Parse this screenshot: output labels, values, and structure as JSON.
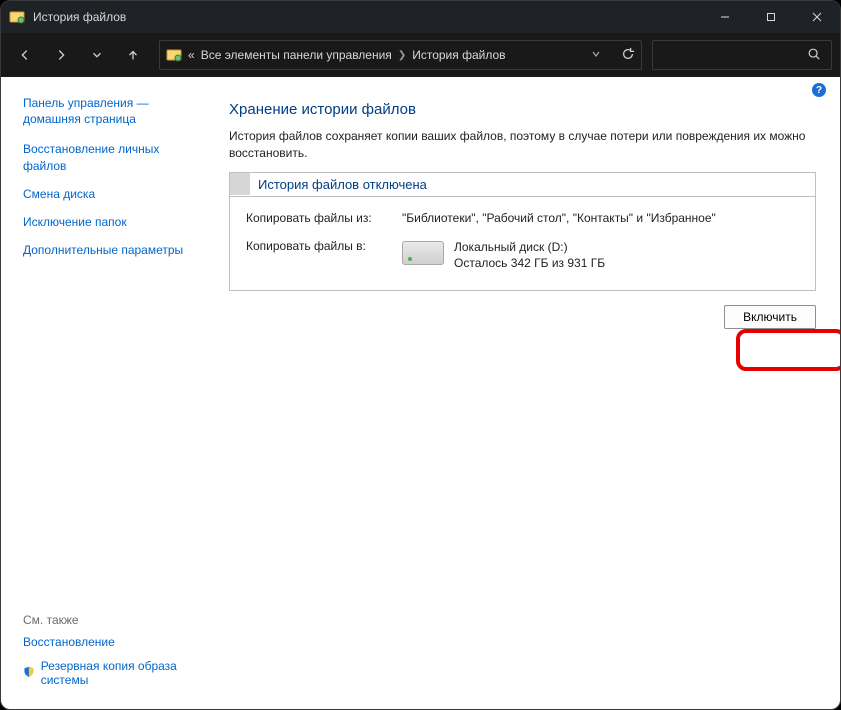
{
  "window": {
    "title": "История файлов"
  },
  "breadcrumb": {
    "prefix": "«",
    "segment1": "Все элементы панели управления",
    "segment2": "История файлов"
  },
  "sidebar": {
    "home": "Панель управления — домашняя страница",
    "links": [
      "Восстановление личных файлов",
      "Смена диска",
      "Исключение папок",
      "Дополнительные параметры"
    ],
    "related_title": "См. также",
    "related": [
      "Восстановление",
      "Резервная копия образа системы"
    ]
  },
  "main": {
    "heading": "Хранение истории файлов",
    "subtitle": "История файлов сохраняет копии ваших файлов, поэтому в случае потери или повреждения их можно восстановить.",
    "status_title": "История файлов отключена",
    "copy_from_label": "Копировать файлы из:",
    "copy_from_value": "\"Библиотеки\", \"Рабочий стол\", \"Контакты\" и \"Избранное\"",
    "copy_to_label": "Копировать файлы в:",
    "drive_name": "Локальный диск (D:)",
    "drive_space": "Осталось 342 ГБ из 931 ГБ",
    "enable_button": "Включить"
  }
}
